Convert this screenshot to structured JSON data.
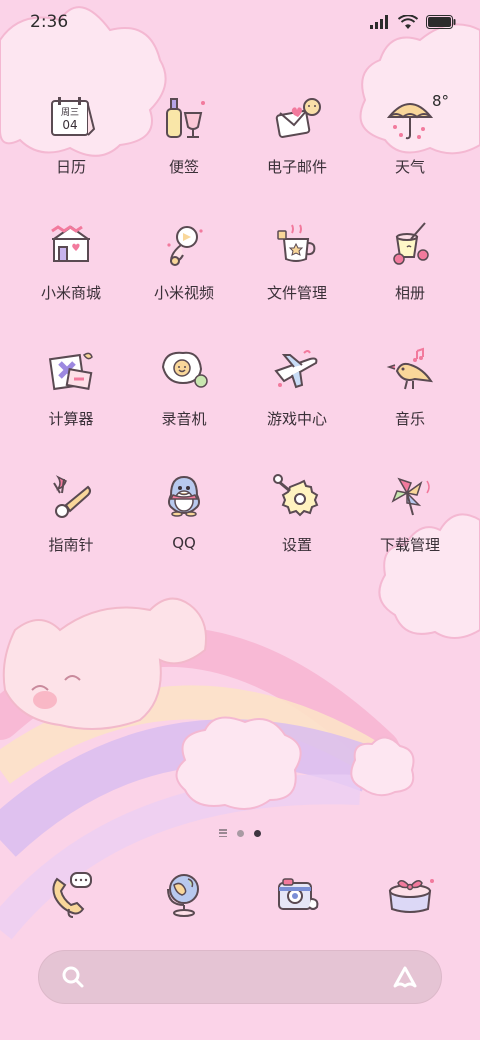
{
  "status_bar": {
    "time": "2:36",
    "icons": [
      "signal-icon",
      "wifi-icon",
      "battery-icon"
    ]
  },
  "weather_widget": {
    "temperature": "8°"
  },
  "calendar_icon": {
    "weekday": "周三",
    "day": "04"
  },
  "apps": [
    {
      "label": "日历",
      "icon": "calendar-icon"
    },
    {
      "label": "便签",
      "icon": "notes-icon"
    },
    {
      "label": "电子邮件",
      "icon": "email-icon"
    },
    {
      "label": "天气",
      "icon": "weather-umbrella-icon"
    },
    {
      "label": "小米商城",
      "icon": "mi-store-icon"
    },
    {
      "label": "小米视频",
      "icon": "mi-video-icon"
    },
    {
      "label": "文件管理",
      "icon": "file-manager-icon"
    },
    {
      "label": "相册",
      "icon": "gallery-icon"
    },
    {
      "label": "计算器",
      "icon": "calculator-icon"
    },
    {
      "label": "录音机",
      "icon": "recorder-icon"
    },
    {
      "label": "游戏中心",
      "icon": "game-center-icon"
    },
    {
      "label": "音乐",
      "icon": "music-icon"
    },
    {
      "label": "指南针",
      "icon": "compass-icon"
    },
    {
      "label": "QQ",
      "icon": "qq-icon"
    },
    {
      "label": "设置",
      "icon": "settings-icon"
    },
    {
      "label": "下载管理",
      "icon": "download-manager-icon"
    }
  ],
  "dock": [
    {
      "icon": "phone-icon"
    },
    {
      "icon": "browser-globe-icon"
    },
    {
      "icon": "camera-icon"
    },
    {
      "icon": "gift-box-icon"
    }
  ],
  "page_indicator": {
    "pages": 2,
    "active_index": 1
  },
  "search": {
    "placeholder": ""
  },
  "colors": {
    "background": "#fbd3e8",
    "cloud": "#fde6f1",
    "rainbow_pink": "#f7b6d3",
    "rainbow_lilac": "#d9bdf0",
    "dock_search_bg": "#e5c4d4"
  }
}
